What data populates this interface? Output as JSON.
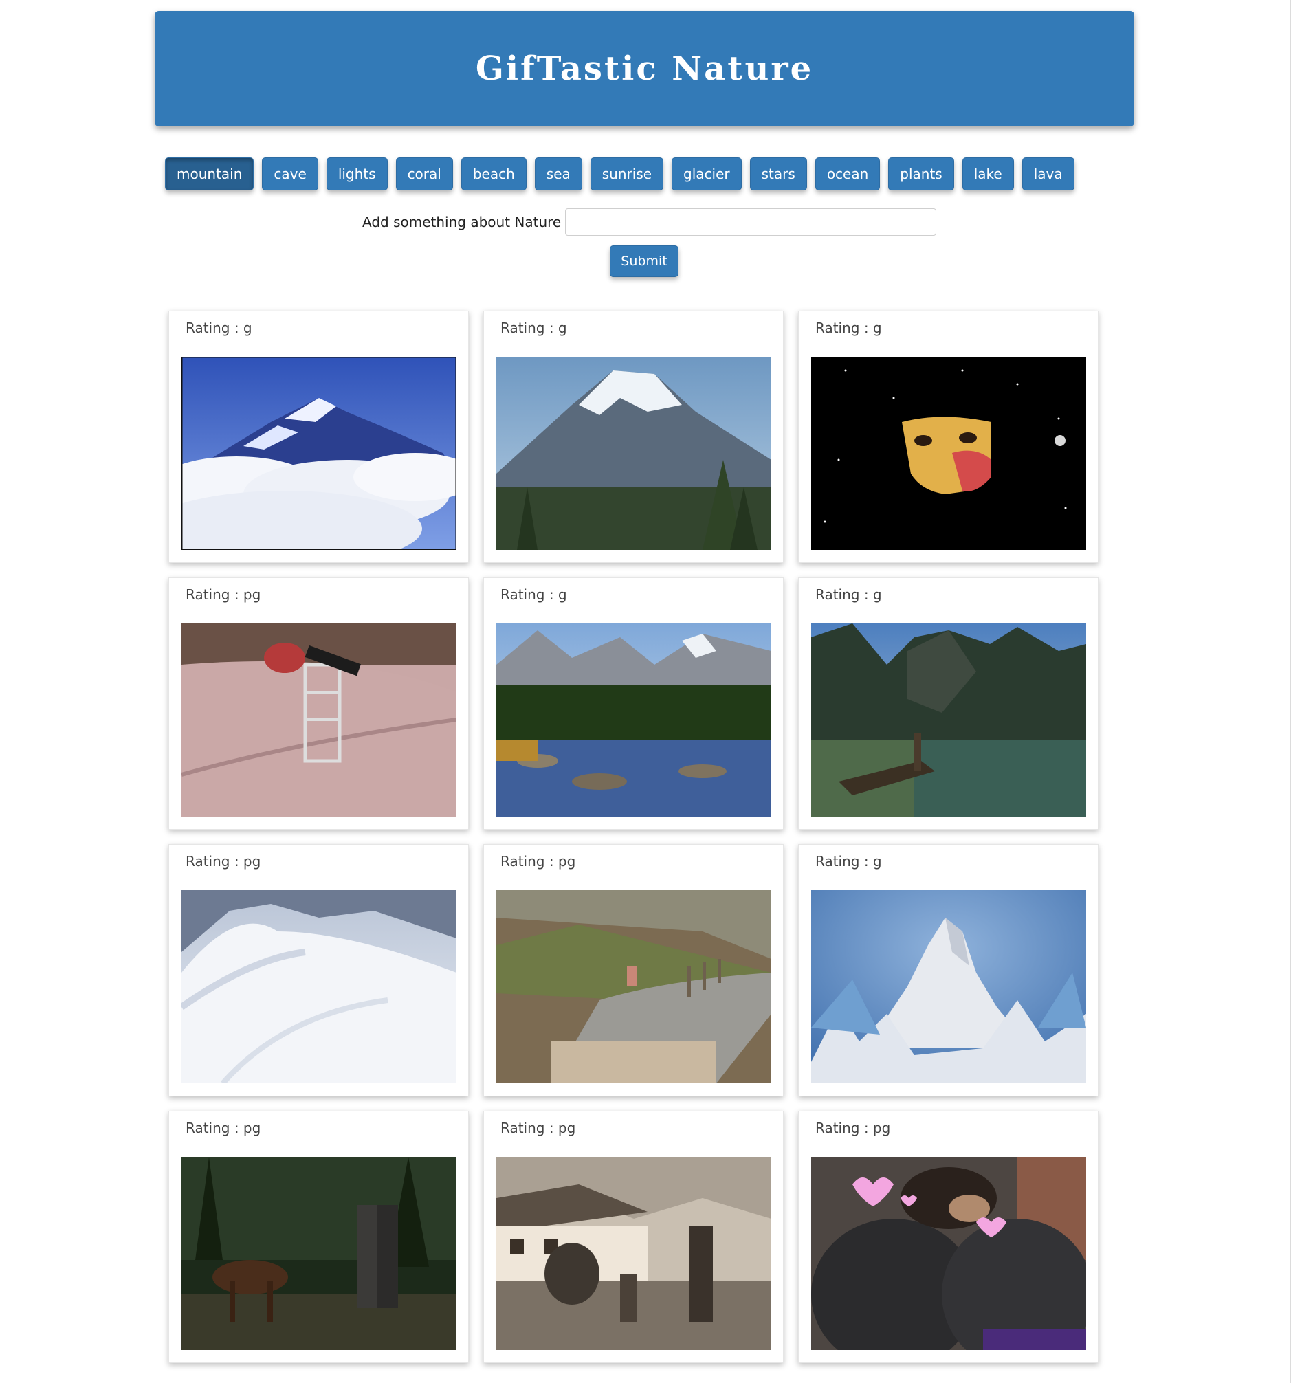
{
  "header": {
    "title": "GifTastic Nature"
  },
  "topics": [
    "mountain",
    "cave",
    "lights",
    "coral",
    "beach",
    "sea",
    "sunrise",
    "glacier",
    "stars",
    "ocean",
    "plants",
    "lake",
    "lava"
  ],
  "active_topic": "mountain",
  "form": {
    "label": "Add something about Nature",
    "input_value": "",
    "submit_label": "Submit"
  },
  "rating_prefix": "Rating : ",
  "gifs": [
    {
      "rating": "g",
      "scene": "everest-clouds"
    },
    {
      "rating": "g",
      "scene": "snow-volcano"
    },
    {
      "rating": "g",
      "scene": "face-in-space"
    },
    {
      "rating": "pg",
      "scene": "skate-pool"
    },
    {
      "rating": "g",
      "scene": "river-valley"
    },
    {
      "rating": "g",
      "scene": "alpine-lake"
    },
    {
      "rating": "pg",
      "scene": "snow-ridge"
    },
    {
      "rating": "pg",
      "scene": "trail-walk"
    },
    {
      "rating": "g",
      "scene": "ice-peak"
    },
    {
      "rating": "pg",
      "scene": "forest-couple"
    },
    {
      "rating": "pg",
      "scene": "sepia-village"
    },
    {
      "rating": "pg",
      "scene": "dog-hug-hearts"
    }
  ]
}
